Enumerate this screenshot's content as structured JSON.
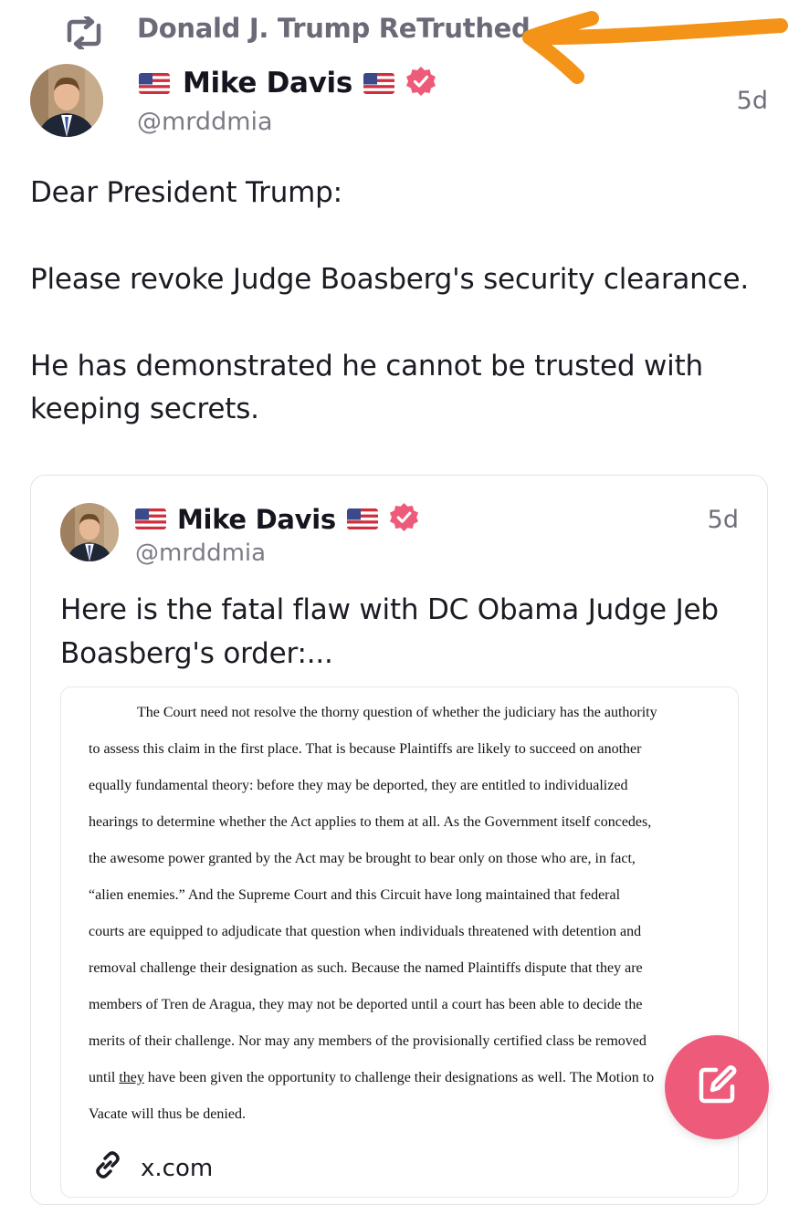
{
  "retruth": {
    "icon": "retruth-icon",
    "label": "Donald J. Trump ReTruthed"
  },
  "annotation": {
    "arrow_color": "#f39317"
  },
  "post": {
    "author": {
      "display_name": "Mike Davis",
      "handle": "@mrddmia",
      "flag_icon": "us-flag-icon",
      "verified_icon": "verified-badge-icon",
      "verified_color": "#ee5a79"
    },
    "time": "5d",
    "paragraphs": [
      "Dear President Trump:",
      "Please revoke Judge Boasberg's security clearance.",
      "He has demonstrated he cannot be trusted with keeping secrets."
    ]
  },
  "quoted_post": {
    "author": {
      "display_name": "Mike Davis",
      "handle": "@mrddmia"
    },
    "time": "5d",
    "text": "Here is the fatal flaw with DC Obama Judge Jeb Boasberg's order:...",
    "document_lines": [
      "The Court need not resolve the thorny question of whether the judiciary has the authority",
      "to assess this claim in the first place.  That is because Plaintiffs are likely to succeed on another",
      "equally fundamental theory: before they may be deported, they are entitled to individualized",
      "hearings to determine whether the Act applies to them at all.  As the Government itself concedes,",
      "the awesome power granted by the Act may be brought to bear only on those who are, in fact,",
      "“alien enemies.”  And the Supreme Court and this Circuit have long maintained that federal",
      "courts are equipped to adjudicate that question when individuals threatened with detention and",
      "removal challenge their designation as such.  Because the named Plaintiffs dispute that they are",
      "members of Tren de Aragua, they may not be deported until a court has been able to decide the",
      "merits of their challenge.  Nor may any members of the provisionally certified class be removed",
      "until",
      "they",
      "have been given the opportunity to challenge their designations as well.  The Motion to",
      "Vacate will thus be denied."
    ],
    "link": {
      "icon": "link-icon",
      "label": "x.com"
    }
  },
  "compose_button": {
    "icon": "compose-icon",
    "color": "#ee5a79"
  }
}
